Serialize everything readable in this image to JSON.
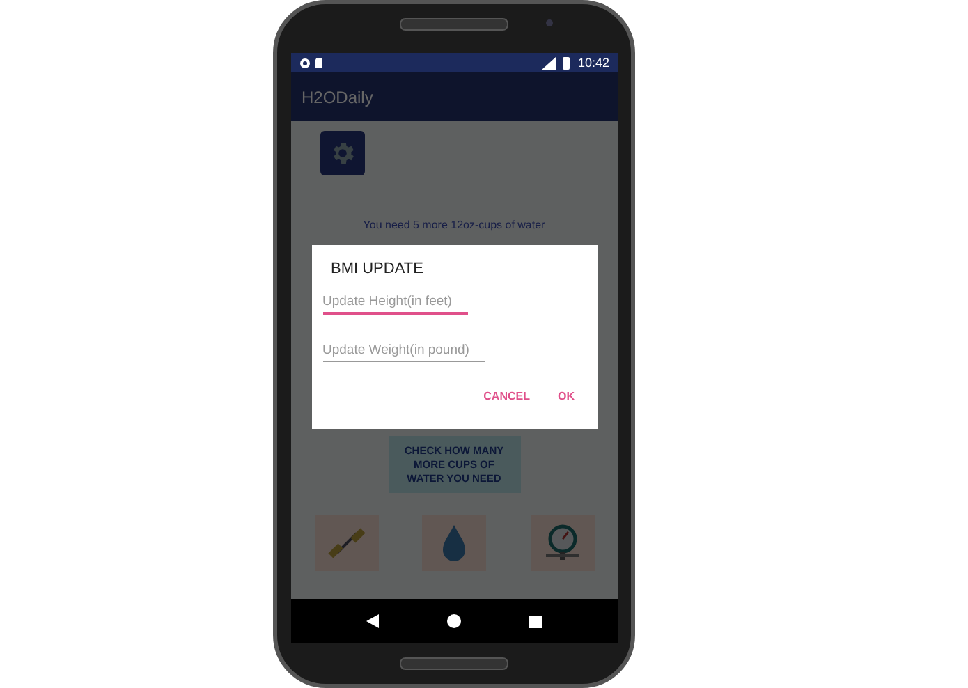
{
  "status_bar": {
    "time": "10:42"
  },
  "app_bar": {
    "title": "H2ODaily"
  },
  "message": "You need 5 more 12oz-cups of water",
  "check_button": {
    "label": "CHECK HOW MANY MORE CUPS OF WATER YOU NEED"
  },
  "image_buttons": [
    {
      "kind": "dumbbell"
    },
    {
      "kind": "drop"
    },
    {
      "kind": "gauge"
    }
  ],
  "dialog": {
    "title": "BMI UPDATE",
    "fields": [
      {
        "placeholder": "Update Height(in feet)",
        "focused": true
      },
      {
        "placeholder": "Update Weight(in pound)",
        "focused": false
      }
    ],
    "buttons": [
      "CANCEL",
      "OK"
    ]
  }
}
